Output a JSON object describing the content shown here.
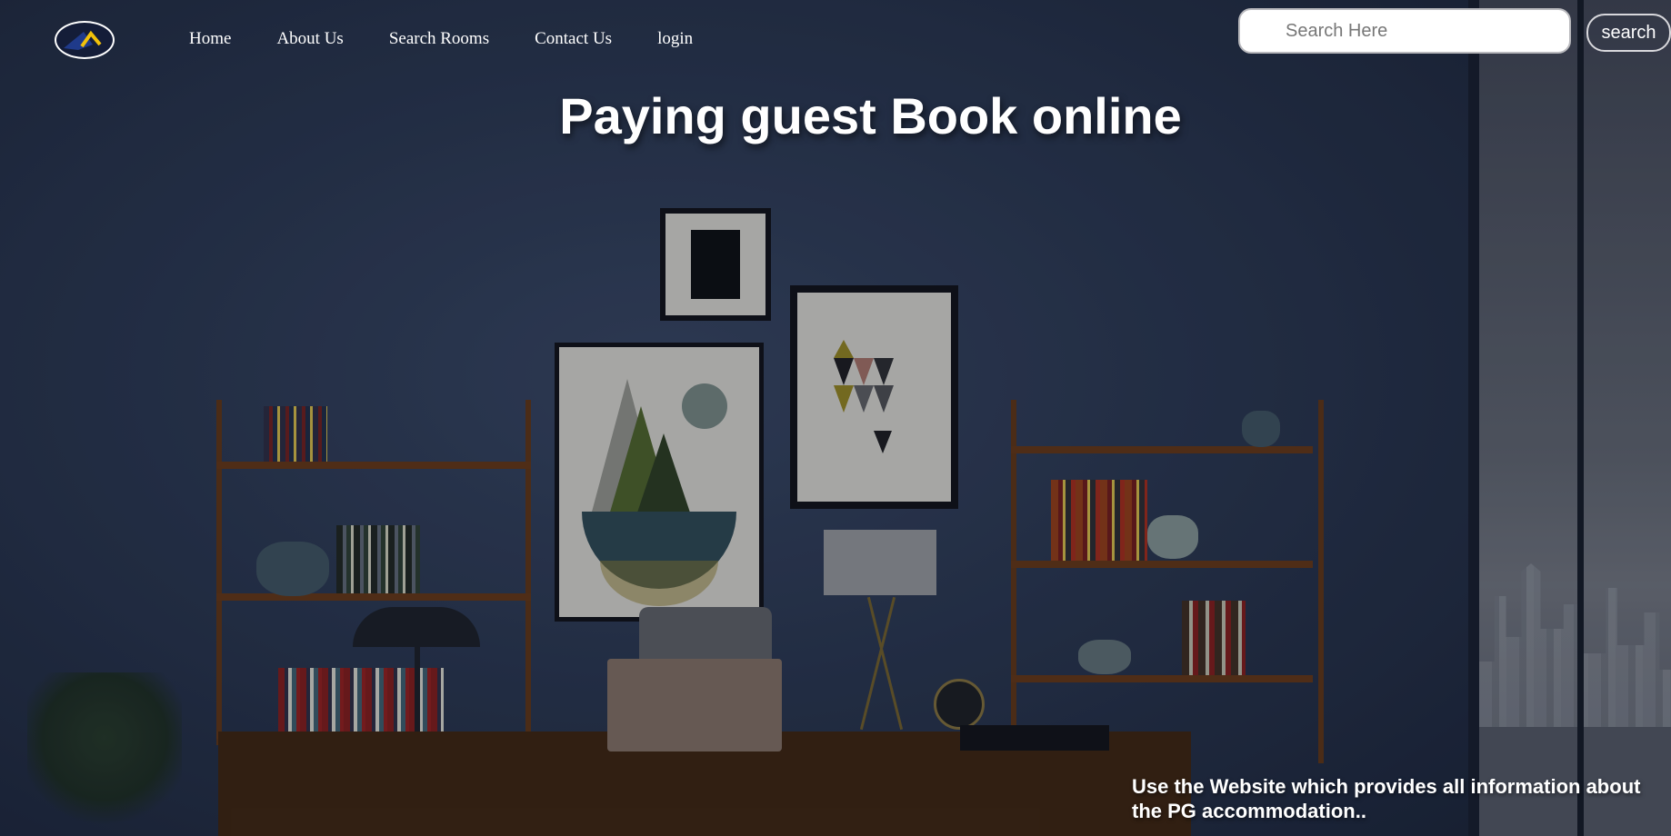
{
  "nav": {
    "logo_icon": "house-roof-logo",
    "links": [
      {
        "label": "Home"
      },
      {
        "label": "About Us"
      },
      {
        "label": "Search Rooms"
      },
      {
        "label": "Contact Us"
      },
      {
        "label": "login"
      }
    ]
  },
  "search": {
    "placeholder": "Search Here",
    "value": "",
    "button_label": "search"
  },
  "hero": {
    "title": "Paying guest Book online",
    "subtitle": "Use the Website which provides all information about the PG accommodation.."
  },
  "colors": {
    "wall": "#28344d",
    "text": "#ffffff",
    "logo_yellow": "#f2c20a",
    "logo_blue": "#1f3a8a"
  }
}
